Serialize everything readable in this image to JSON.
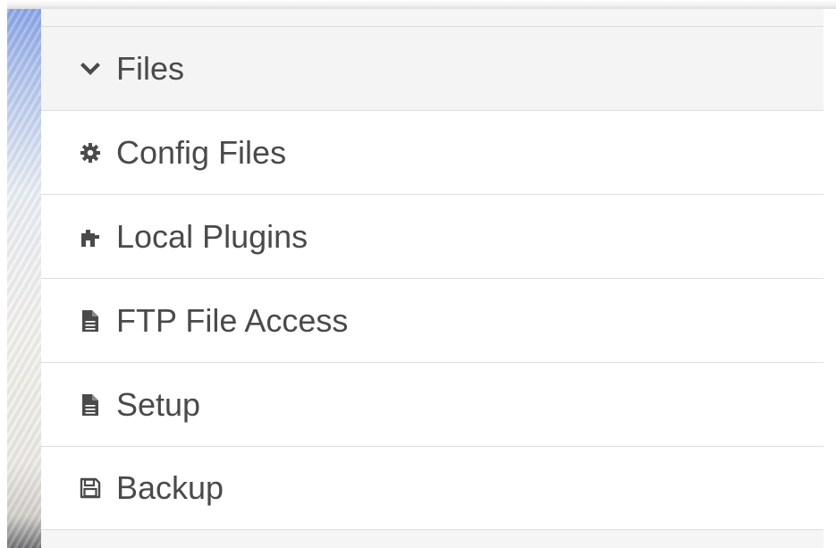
{
  "menu": {
    "header": {
      "label": "Files",
      "icon": "chevron-down-icon"
    },
    "items": [
      {
        "label": "Config Files",
        "icon": "gear-icon"
      },
      {
        "label": "Local Plugins",
        "icon": "puzzle-icon"
      },
      {
        "label": "FTP File Access",
        "icon": "document-icon"
      },
      {
        "label": "Setup",
        "icon": "document-icon"
      },
      {
        "label": "Backup",
        "icon": "floppy-disk-icon"
      }
    ]
  },
  "colors": {
    "text": "#4a4a4a",
    "header_background": "#f4f4f4",
    "divider": "#dedede"
  }
}
